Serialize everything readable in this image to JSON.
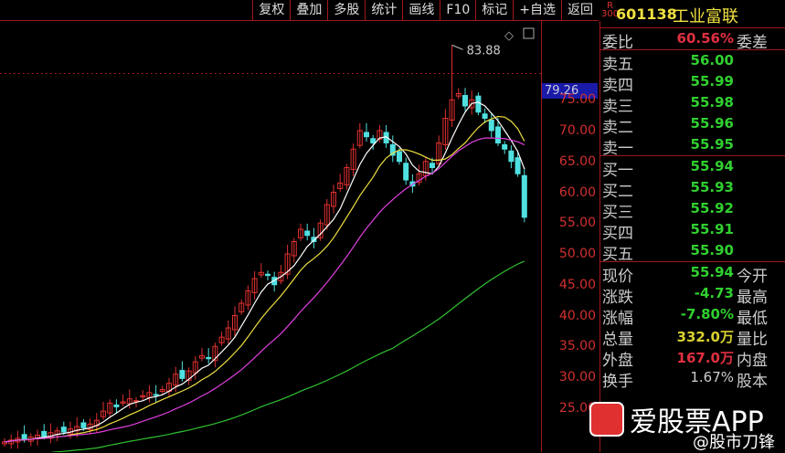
{
  "toolbar": {
    "items": [
      "复权",
      "叠加",
      "多股",
      "统计",
      "画线",
      "F10",
      "标记",
      "+自选",
      "返回"
    ]
  },
  "stock": {
    "badge_top": "R",
    "badge_bottom": "300",
    "code": "601138",
    "name": "工业富联"
  },
  "yaxis": {
    "labels": [
      "75.00",
      "70.00",
      "65.00",
      "60.00",
      "55.00",
      "50.00",
      "45.00",
      "40.00",
      "35.00",
      "30.00",
      "25.00"
    ],
    "current": "79.26"
  },
  "weibi": {
    "label": "委比",
    "value": "60.56%",
    "right": "委差"
  },
  "sell": [
    {
      "label": "卖五",
      "value": "56.00"
    },
    {
      "label": "卖四",
      "value": "55.99"
    },
    {
      "label": "卖三",
      "value": "55.98"
    },
    {
      "label": "卖二",
      "value": "55.96"
    },
    {
      "label": "卖一",
      "value": "55.95"
    }
  ],
  "buy": [
    {
      "label": "买一",
      "value": "55.94"
    },
    {
      "label": "买二",
      "value": "55.93"
    },
    {
      "label": "买三",
      "value": "55.92"
    },
    {
      "label": "买四",
      "value": "55.91"
    },
    {
      "label": "买五",
      "value": "55.90"
    }
  ],
  "stats": [
    {
      "label": "现价",
      "value": "55.94",
      "right": "今开"
    },
    {
      "label": "涨跌",
      "value": "-4.73",
      "right": "最高"
    },
    {
      "label": "涨幅",
      "value": "-7.80%",
      "right": "最低"
    },
    {
      "label": "总量",
      "value": "332.0万",
      "right": "量比"
    },
    {
      "label": "外盘",
      "value": "167.0万",
      "right": "内盘"
    },
    {
      "label": "换手",
      "value": "1.67%",
      "right": "股本"
    }
  ],
  "watermark": {
    "app": "爱股票APP",
    "handle": "@股市刀锋"
  },
  "chart_data": {
    "type": "candlestick",
    "peak": {
      "index": 68,
      "value": 83.88,
      "label": "83.88"
    },
    "closes": [
      19.5,
      19.8,
      20.1,
      19.9,
      20.3,
      20.6,
      20.4,
      21,
      21.3,
      21.1,
      21.6,
      22,
      21.8,
      22.4,
      23,
      24.5,
      25.8,
      25.2,
      26,
      26.5,
      26.2,
      27,
      27.5,
      27.1,
      28,
      29,
      30.5,
      29.8,
      31,
      32.5,
      33.5,
      33,
      35,
      36.5,
      38,
      40,
      42,
      44,
      46,
      47,
      46.5,
      45,
      47,
      50,
      52,
      54,
      53,
      52,
      55,
      58,
      60,
      61.5,
      64,
      67,
      70,
      69,
      68,
      70,
      68,
      66,
      65,
      62,
      61,
      63,
      65,
      64,
      68,
      72,
      75,
      76,
      74,
      75,
      73,
      72,
      70,
      68,
      67,
      65,
      63,
      55.94
    ],
    "ma_periods": [
      5,
      10,
      20,
      60
    ],
    "ma_colors": [
      "#ffffff",
      "#f0e040",
      "#e040e0",
      "#30c030"
    ]
  }
}
